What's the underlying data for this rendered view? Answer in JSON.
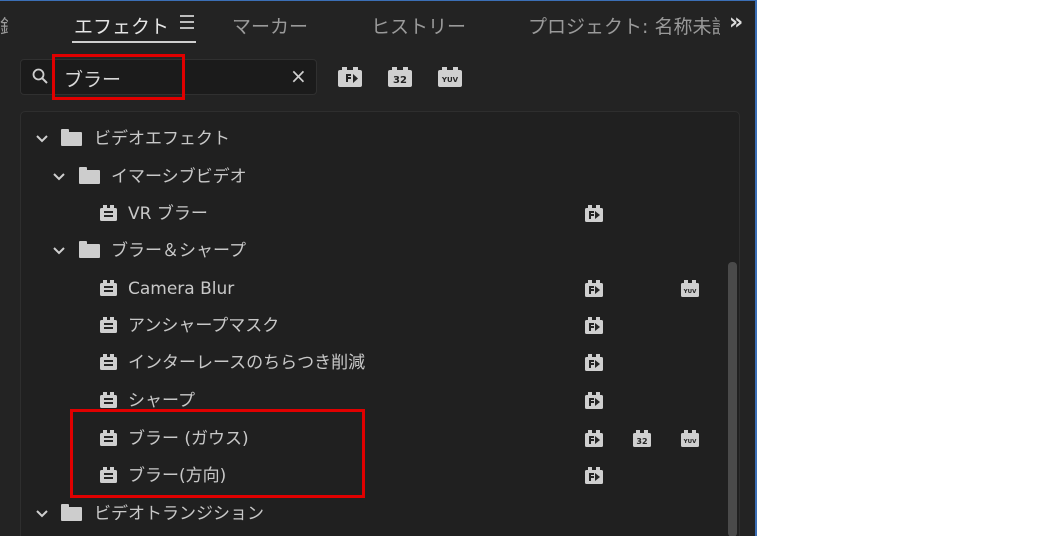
{
  "tabs": {
    "active": "エフェクト",
    "markers": "マーカー",
    "history": "ヒストリー",
    "project": "プロジェクト: 名称未設",
    "cut_left": "録",
    "overflow": "»"
  },
  "search": {
    "value": "ブラー",
    "clear": "×"
  },
  "filters": {
    "accelerated": "accelerated-effects-icon",
    "bit32": "32",
    "yuv": "YUV"
  },
  "tree": {
    "video_effects": "ビデオエフェクト",
    "immersive": "イマーシブビデオ",
    "vr_blur": "VR ブラー",
    "blur_sharpen": "ブラー＆シャープ",
    "camera_blur": "Camera Blur",
    "unsharp_mask": "アンシャープマスク",
    "interlace": "インターレースのちらつき削減",
    "sharpen": "シャープ",
    "gaussian": "ブラー (ガウス)",
    "directional": "ブラー(方向)",
    "video_transitions": "ビデオトランジション"
  },
  "colors": {
    "highlight": "#e00000",
    "panel": "#232323",
    "accent_border": "#3b6fb6"
  }
}
